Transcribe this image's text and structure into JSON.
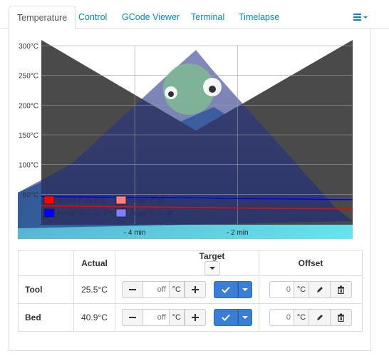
{
  "tabs": [
    {
      "label": "Temperature"
    },
    {
      "label": "Control"
    },
    {
      "label": "GCode Viewer"
    },
    {
      "label": "Terminal"
    },
    {
      "label": "Timelapse"
    }
  ],
  "chart_data": {
    "type": "line",
    "y_ticks": [
      "300°C",
      "250°C",
      "200°C",
      "150°C",
      "100°C",
      "50°C"
    ],
    "x_ticks": [
      "- 4 min",
      "- 2 min"
    ],
    "ylim": [
      0,
      300
    ],
    "legend": [
      {
        "name": "Actual T: 25.5°C",
        "color": "#ff0000"
      },
      {
        "name": "Target T: off",
        "color": "#ff8080"
      },
      {
        "name": "Actual Bed: 40.9°C",
        "color": "#0000ff"
      },
      {
        "name": "Target Bed: off",
        "color": "#8080ff"
      }
    ],
    "series": [
      {
        "name": "Actual T: 25.5°C",
        "color": "#ff0000",
        "values": [
          31,
          30,
          29,
          28.5,
          28,
          27,
          26.5,
          26,
          25.5
        ]
      },
      {
        "name": "Actual Bed: 40.9°C",
        "color": "#0000ff",
        "values": [
          46,
          45.5,
          45,
          44.5,
          44,
          43,
          42.5,
          41.5,
          40.9
        ]
      }
    ]
  },
  "table": {
    "headers": {
      "actual": "Actual",
      "target": "Target",
      "offset": "Offset"
    },
    "rows": [
      {
        "name": "Tool",
        "actual": "25.5°C",
        "target_placeholder": "off",
        "unit": "°C",
        "offset_placeholder": "0",
        "offset_unit": "°C"
      },
      {
        "name": "Bed",
        "actual": "40.9°C",
        "target_placeholder": "off",
        "unit": "°C",
        "offset_placeholder": "0",
        "offset_unit": "°C"
      }
    ]
  }
}
